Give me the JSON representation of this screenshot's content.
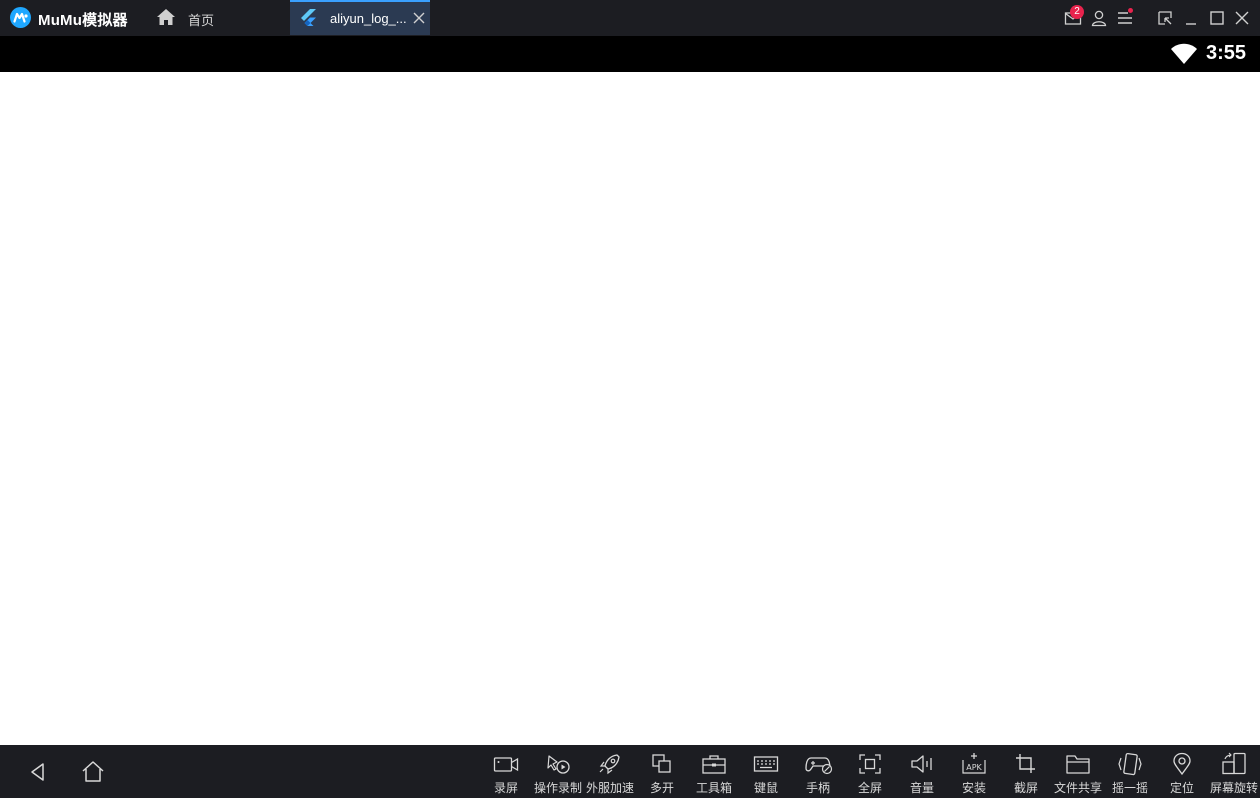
{
  "titlebar": {
    "app_name": "MuMu模拟器",
    "home_tab_label": "首页",
    "active_tab_label": "aliyun_log_...",
    "mail_badge_count": "2",
    "icons": [
      "mail-icon",
      "user-icon",
      "menu-icon",
      "shrink-window-icon",
      "minimize-icon",
      "maximize-icon",
      "close-icon"
    ]
  },
  "statusbar": {
    "time": "3:55"
  },
  "bottombar": {
    "tools": [
      {
        "label": "录屏",
        "icon": "video-record-icon"
      },
      {
        "label": "操作录制",
        "icon": "macro-record-icon"
      },
      {
        "label": "外服加速",
        "icon": "rocket-icon"
      },
      {
        "label": "多开",
        "icon": "multi-instance-icon"
      },
      {
        "label": "工具箱",
        "icon": "toolbox-icon"
      },
      {
        "label": "键鼠",
        "icon": "keyboard-icon"
      },
      {
        "label": "手柄",
        "icon": "gamepad-icon"
      },
      {
        "label": "全屏",
        "icon": "fullscreen-icon"
      },
      {
        "label": "音量",
        "icon": "volume-icon"
      },
      {
        "label": "安装",
        "icon": "apk-install-icon"
      },
      {
        "label": "截屏",
        "icon": "crop-icon"
      },
      {
        "label": "文件共享",
        "icon": "folder-icon"
      },
      {
        "label": "摇一摇",
        "icon": "shake-icon"
      },
      {
        "label": "定位",
        "icon": "location-icon"
      },
      {
        "label": "屏幕旋转",
        "icon": "rotate-screen-icon"
      }
    ]
  },
  "colors": {
    "chrome_bg": "#1c1d22",
    "active_tab_bg": "#2b3a52",
    "accent": "#3aa0ff",
    "badge": "#e8234d"
  }
}
